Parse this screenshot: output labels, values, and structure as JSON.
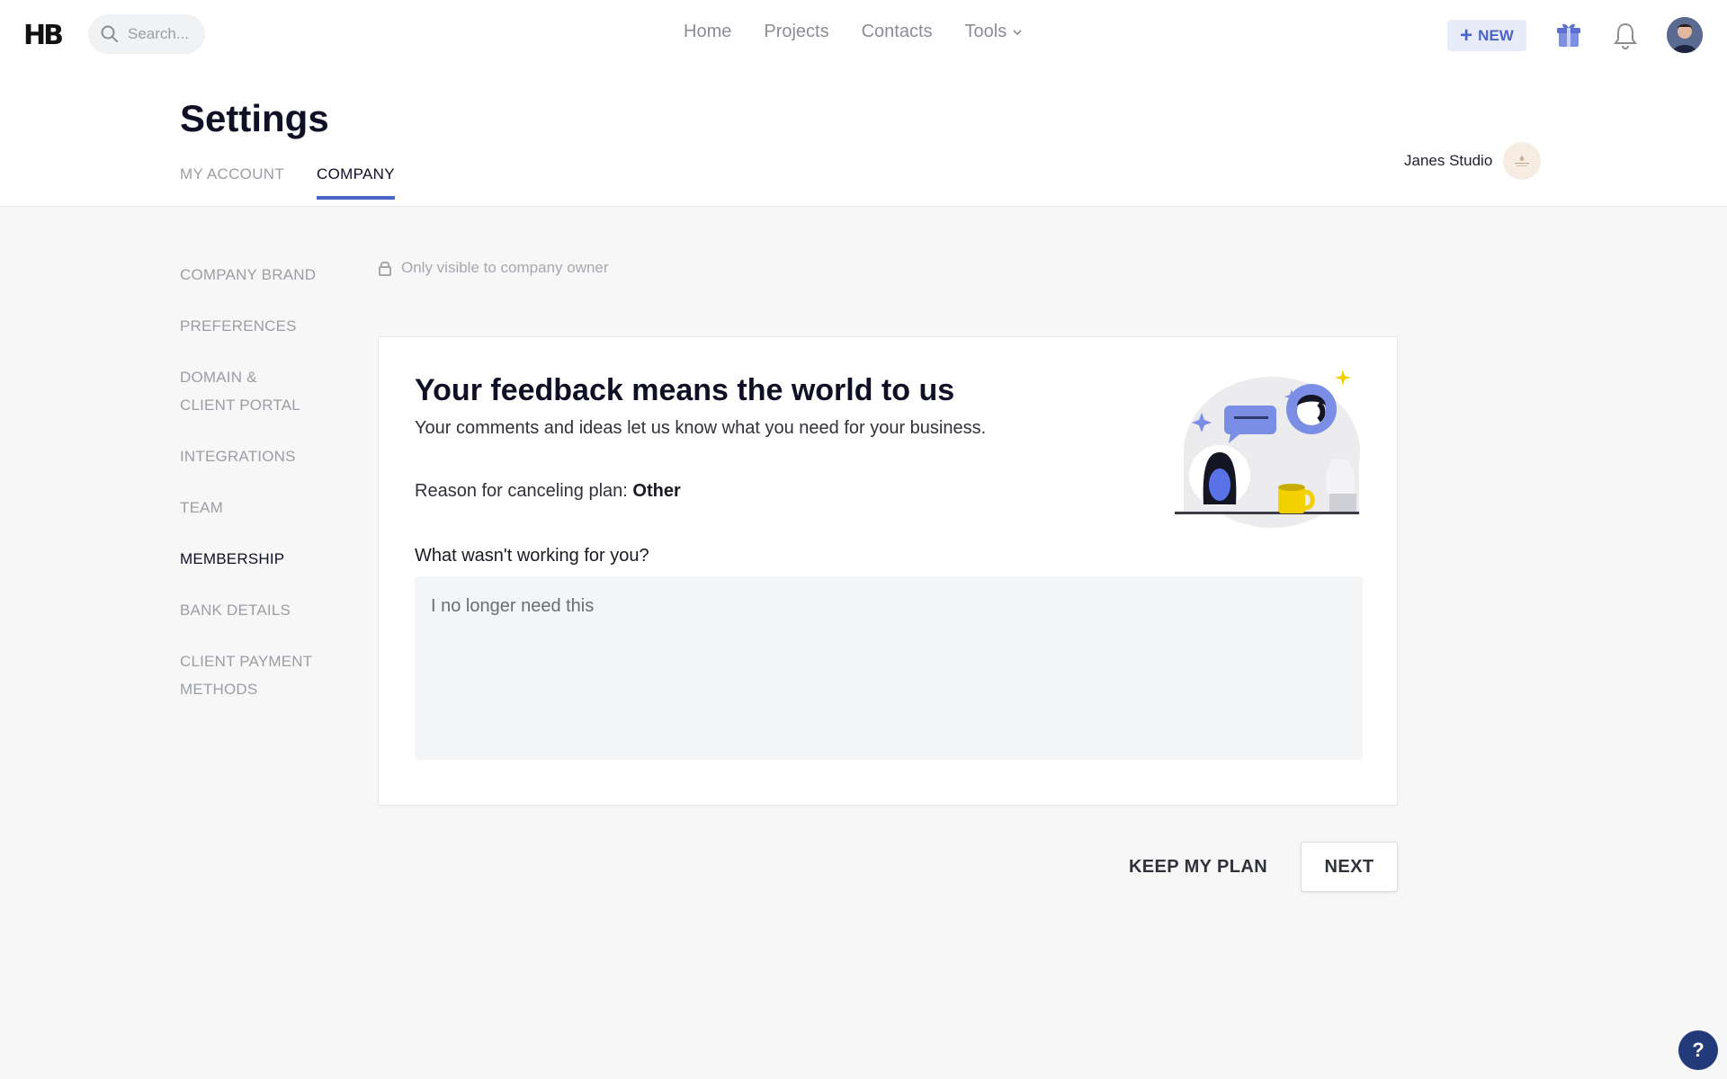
{
  "topbar": {
    "logo": "HB",
    "search_placeholder": "Search...",
    "nav": {
      "home": "Home",
      "projects": "Projects",
      "contacts": "Contacts",
      "tools": "Tools"
    },
    "new_label": "NEW",
    "icons": [
      "search-icon",
      "chevron-down-icon",
      "plus-icon",
      "gift-icon",
      "bell-icon",
      "avatar"
    ]
  },
  "header": {
    "title": "Settings",
    "tabs": {
      "my_account": "MY ACCOUNT",
      "company": "COMPANY"
    },
    "active_tab": "COMPANY",
    "company_name": "Janes Studio"
  },
  "sidebar": {
    "items": [
      "COMPANY BRAND",
      "PREFERENCES",
      "DOMAIN & CLIENT PORTAL",
      "INTEGRATIONS",
      "TEAM",
      "MEMBERSHIP",
      "BANK DETAILS",
      "CLIENT PAYMENT METHODS"
    ],
    "active": "MEMBERSHIP"
  },
  "privacy_note": "Only visible to company owner",
  "card": {
    "title": "Your feedback means the world to us",
    "subtitle": "Your comments and ideas let us know what you need for your business.",
    "reason_label": "Reason for canceling plan:",
    "reason_value": "Other",
    "question": "What wasn't working for you?",
    "feedback_value": "I no longer need this"
  },
  "actions": {
    "keep_label": "KEEP MY PLAN",
    "next_label": "NEXT"
  },
  "help_label": "?",
  "colors": {
    "accent": "#4a64c8",
    "background": "#f7f7f8",
    "help_button": "#233a7a"
  }
}
